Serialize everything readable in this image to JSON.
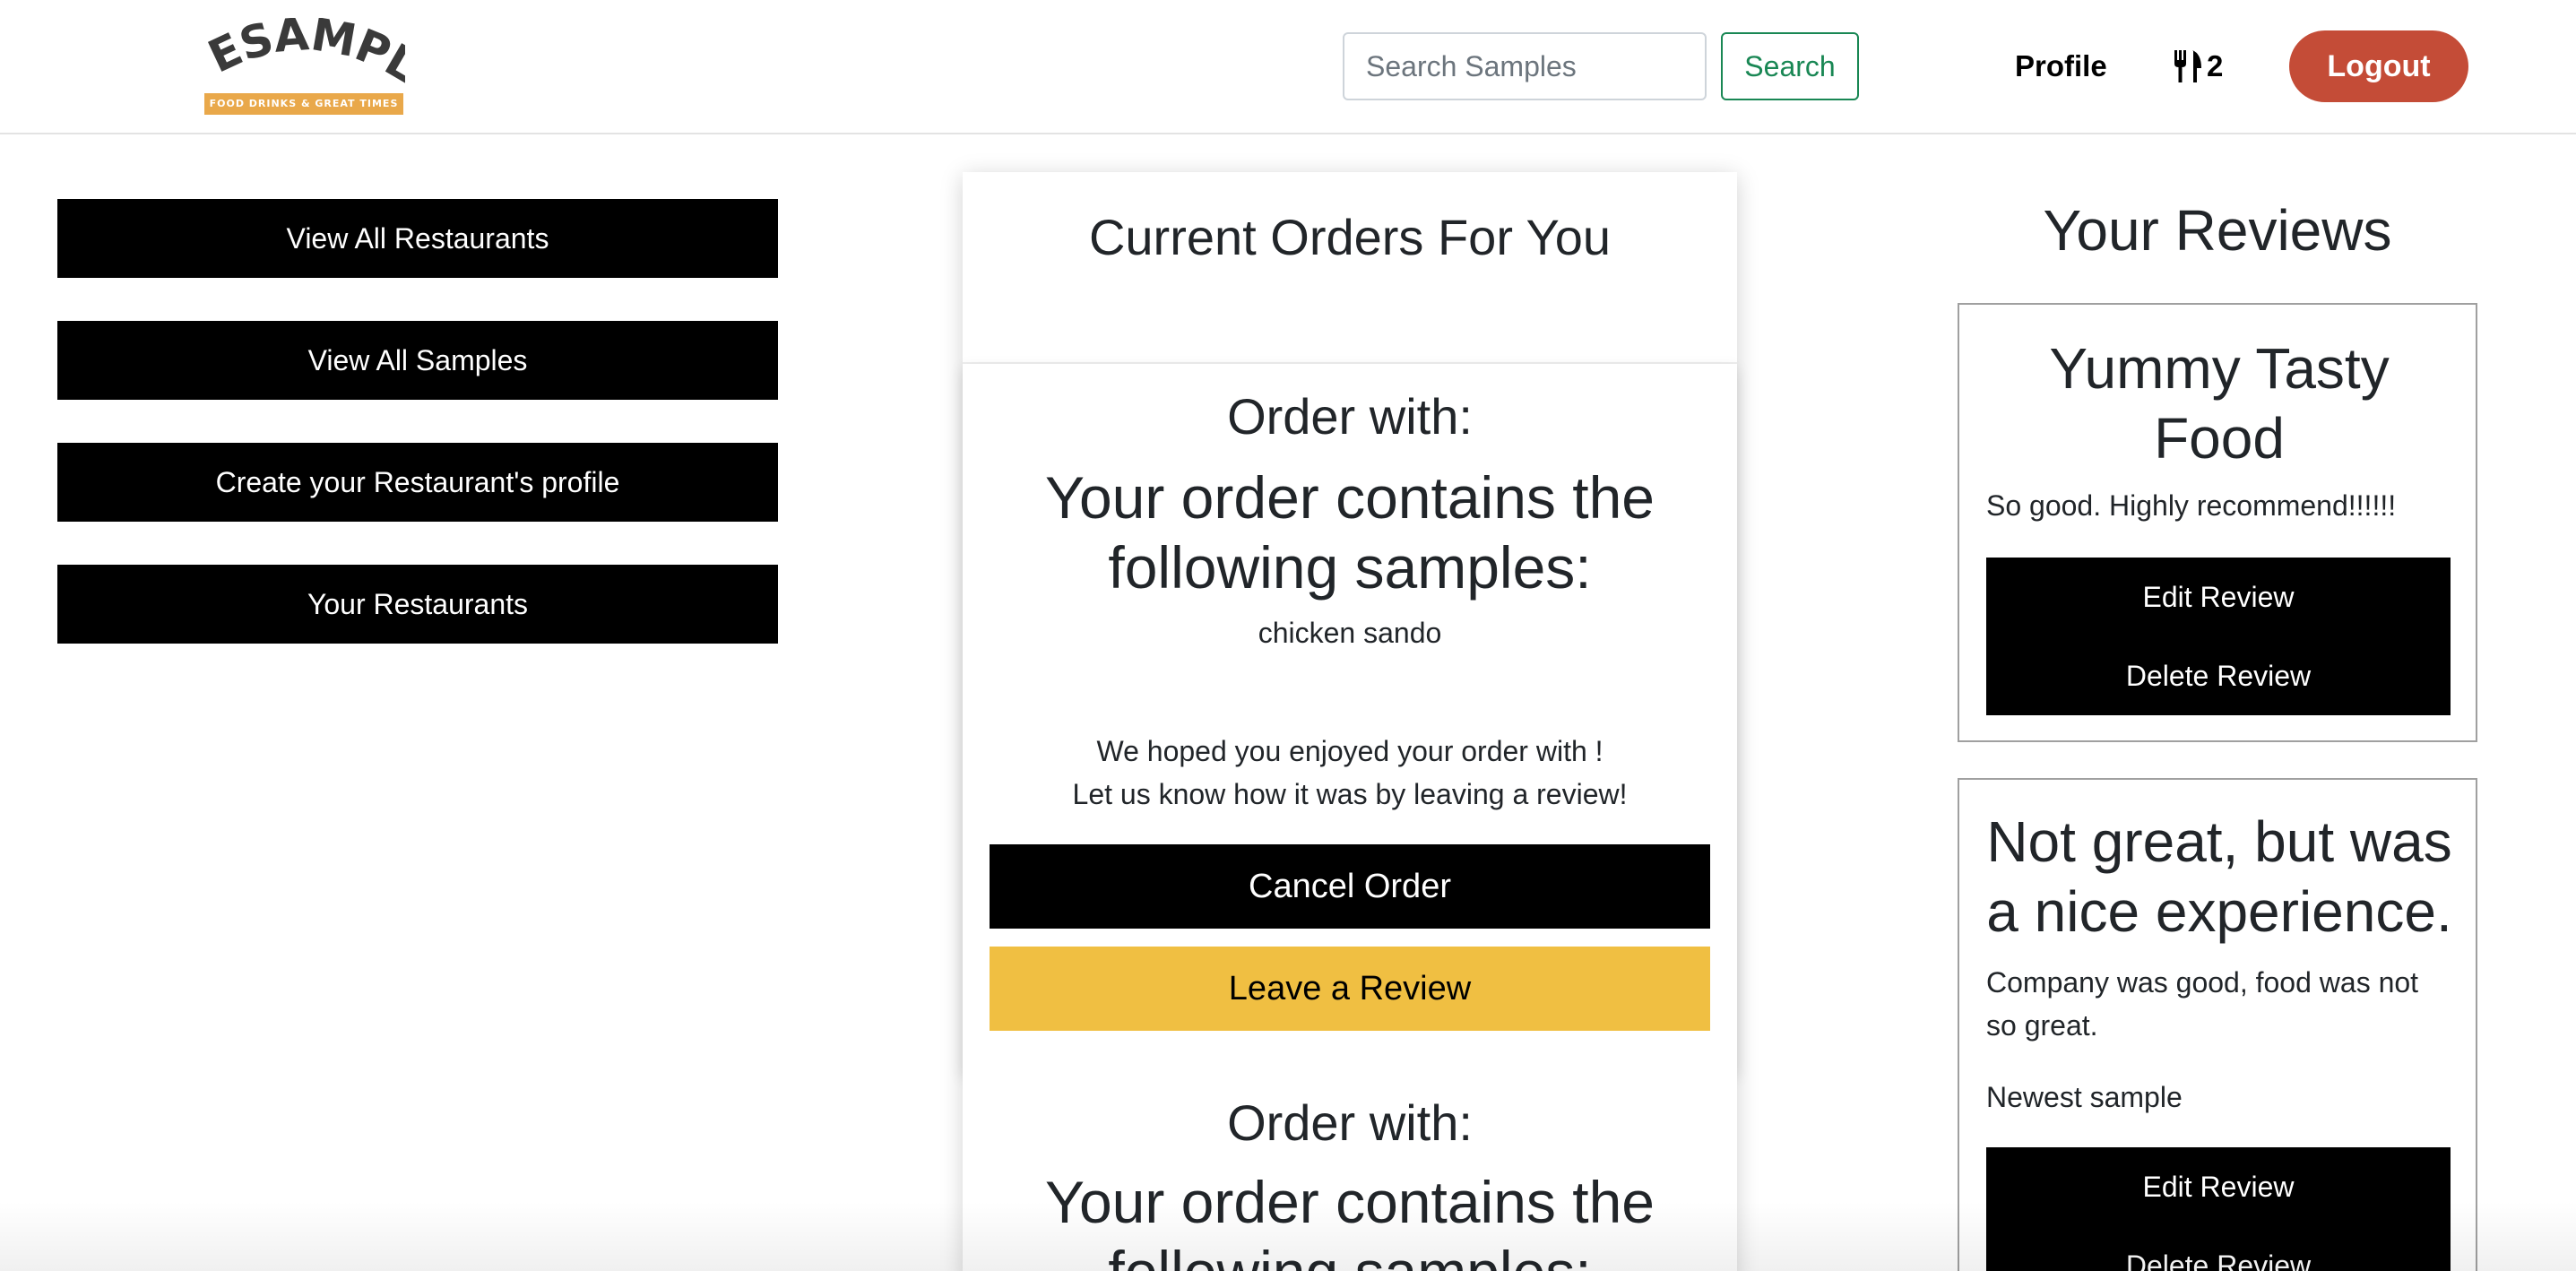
{
  "navbar": {
    "logo_text": "WESAMPLE",
    "logo_tagline": "FOOD DRINKS & GREAT TIMES",
    "search_placeholder": "Search Samples",
    "search_value": "",
    "search_label": "Search",
    "profile_label": "Profile",
    "cart_icon": "fork-knife-icon",
    "cart_count": "2",
    "logout_label": "Logout"
  },
  "sidebar": {
    "items": [
      {
        "label": "View All Restaurants"
      },
      {
        "label": "View All Samples"
      },
      {
        "label": "Create your Restaurant's profile"
      },
      {
        "label": "Your Restaurants"
      }
    ]
  },
  "orders": {
    "title": "Current Orders For You",
    "items": [
      {
        "with_label": "Order with:",
        "contains_label": "Your order contains the following samples:",
        "samples": [
          "chicken sando"
        ],
        "enjoy_line1": "We hoped you enjoyed your order with !",
        "enjoy_line2": "Let us know how it was by leaving a review!",
        "cancel_label": "Cancel Order",
        "review_label": "Leave a Review"
      },
      {
        "with_label": "Order with:",
        "contains_label": "Your order contains the following samples:"
      }
    ]
  },
  "reviews": {
    "title": "Your Reviews",
    "items": [
      {
        "title": "Yummy Tasty Food",
        "body": "So good. Highly recommend!!!!!!",
        "sample": "",
        "edit_label": "Edit Review",
        "delete_label": "Delete Review"
      },
      {
        "title": "Not great, but was a nice experience.",
        "body": "Company was good, food was not so great.",
        "sample": "Newest sample",
        "edit_label": "Edit Review",
        "delete_label": "Delete Review"
      }
    ]
  },
  "colors": {
    "logout": "#c44c37",
    "search_accent": "#198754",
    "review_button": "#f0bf42",
    "logo_tag": "#e9a84a"
  }
}
